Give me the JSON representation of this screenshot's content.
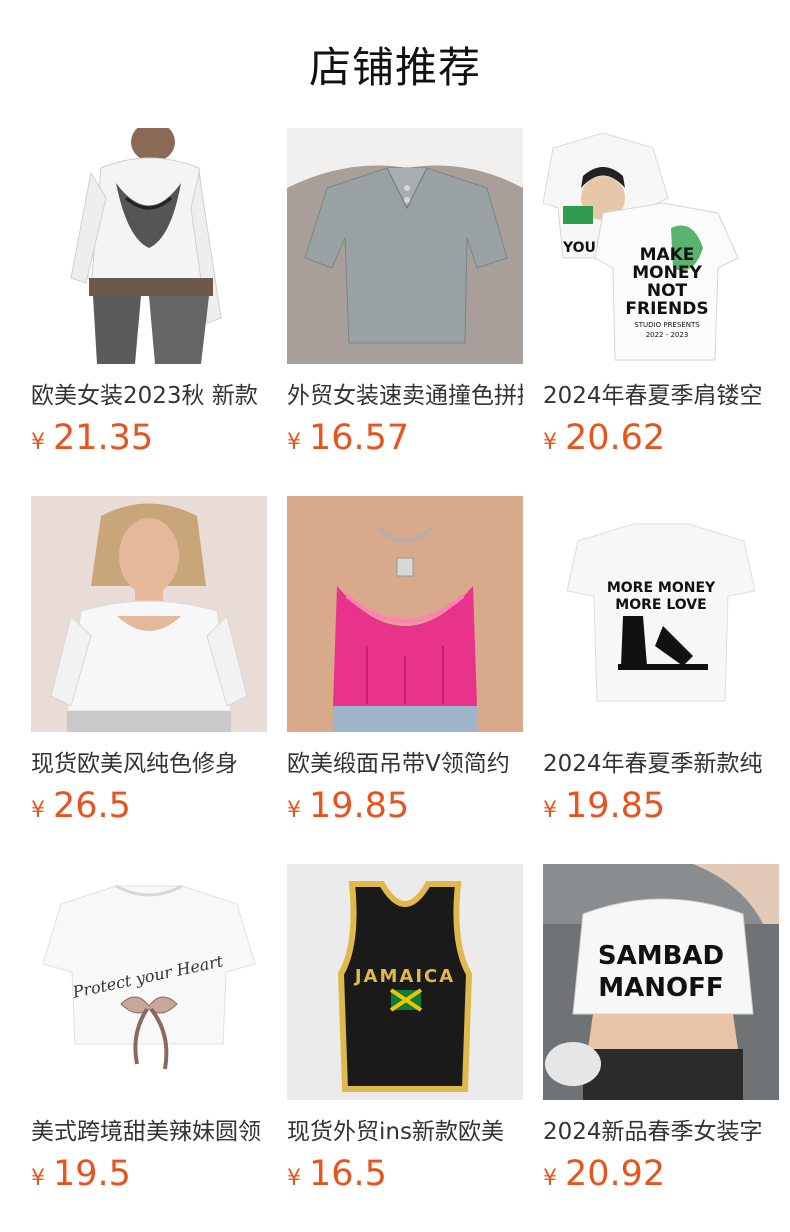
{
  "header": {
    "title": "店铺推荐"
  },
  "currency_symbol": "¥",
  "products": [
    {
      "name": "欧美女装2023秋 新款",
      "price": "21.35"
    },
    {
      "name": "外贸女装速卖通撞色拼接",
      "price": "16.57"
    },
    {
      "name": "2024年春夏季肩镂空",
      "price": "20.62"
    },
    {
      "name": "现货欧美风纯色修身",
      "price": "26.5"
    },
    {
      "name": "欧美缎面吊带V领简约",
      "price": "19.85"
    },
    {
      "name": "2024年春夏季新款纯",
      "price": "19.85"
    },
    {
      "name": "美式跨境甜美辣妹圆领",
      "price": "19.5"
    },
    {
      "name": "现货外贸ins新款欧美",
      "price": "16.5"
    },
    {
      "name": "2024新品春季女装字",
      "price": "20.92"
    }
  ],
  "image_texts": {
    "p3": [
      "MAKE",
      "MONEY",
      "NOT",
      "FRIENDS",
      "STUDIO PRESENTS",
      "2022 - 2023",
      "YOUR"
    ],
    "p6": [
      "MORE MONEY",
      "MORE LOVE"
    ],
    "p7": [
      "Protect your Heart"
    ],
    "p8": [
      "JAMAICA"
    ],
    "p9": [
      "SAMBAD",
      "MANOFF"
    ]
  }
}
